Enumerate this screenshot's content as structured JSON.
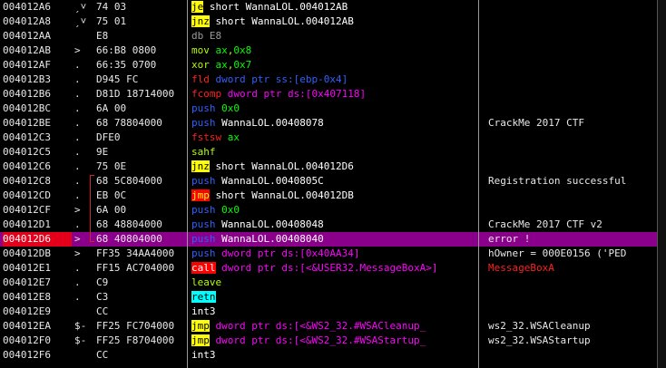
{
  "colors": {
    "background": "#000000",
    "selection": "#8b008b",
    "selected_address": "#e4001b",
    "jump_line": "#cc2a2a"
  },
  "rows": [
    {
      "address": "004012A6",
      "arrow": "ˏ˅",
      "hex": "74 03",
      "comment": "",
      "selected": false,
      "tokens": [
        {
          "t": "je",
          "c": "m-yellow"
        },
        {
          "t": " short WannaLOL.004012AB",
          "c": "c-plain"
        }
      ]
    },
    {
      "address": "004012A8",
      "arrow": "ˏ˅",
      "hex": "75 01",
      "comment": "",
      "selected": false,
      "tokens": [
        {
          "t": "jnz",
          "c": "m-yellow"
        },
        {
          "t": " short WannaLOL.004012AB",
          "c": "c-plain"
        }
      ]
    },
    {
      "address": "004012AA",
      "arrow": "",
      "hex": "E8",
      "comment": "",
      "selected": false,
      "tokens": [
        {
          "t": "db E8",
          "c": "c-gray"
        }
      ]
    },
    {
      "address": "004012AB",
      "arrow": ">",
      "hex": "66:B8 0800",
      "comment": "",
      "selected": false,
      "tokens": [
        {
          "t": "mov ",
          "c": "c-lime"
        },
        {
          "t": "ax",
          "c": "c-green"
        },
        {
          "t": ",",
          "c": "c-lime"
        },
        {
          "t": "0x8",
          "c": "c-green"
        }
      ]
    },
    {
      "address": "004012AF",
      "arrow": ".",
      "hex": "66:35 0700",
      "comment": "",
      "selected": false,
      "tokens": [
        {
          "t": "xor ",
          "c": "c-lime"
        },
        {
          "t": "ax",
          "c": "c-green"
        },
        {
          "t": ",",
          "c": "c-lime"
        },
        {
          "t": "0x7",
          "c": "c-green"
        }
      ]
    },
    {
      "address": "004012B3",
      "arrow": ".",
      "hex": "D945 FC",
      "comment": "",
      "selected": false,
      "tokens": [
        {
          "t": "fld ",
          "c": "c-red"
        },
        {
          "t": "dword ptr ss:[ebp-0x4]",
          "c": "c-blue"
        }
      ]
    },
    {
      "address": "004012B6",
      "arrow": ".",
      "hex": "D81D 18714000",
      "comment": "",
      "selected": false,
      "tokens": [
        {
          "t": "fcomp ",
          "c": "c-red"
        },
        {
          "t": "dword ptr ds:[0x407118]",
          "c": "c-magenta"
        }
      ]
    },
    {
      "address": "004012BC",
      "arrow": ".",
      "hex": "6A 00",
      "comment": "",
      "selected": false,
      "tokens": [
        {
          "t": "push ",
          "c": "c-blue"
        },
        {
          "t": "0x0",
          "c": "c-green"
        }
      ]
    },
    {
      "address": "004012BE",
      "arrow": ".",
      "hex": "68 78804000",
      "comment": "CrackMe 2017 CTF",
      "selected": false,
      "tokens": [
        {
          "t": "push ",
          "c": "c-blue"
        },
        {
          "t": "WannaLOL.00408078",
          "c": "c-plain"
        }
      ]
    },
    {
      "address": "004012C3",
      "arrow": ".",
      "hex": "DFE0",
      "comment": "",
      "selected": false,
      "tokens": [
        {
          "t": "fstsw ",
          "c": "c-red"
        },
        {
          "t": "ax",
          "c": "c-green"
        }
      ]
    },
    {
      "address": "004012C5",
      "arrow": ".",
      "hex": "9E",
      "comment": "",
      "selected": false,
      "tokens": [
        {
          "t": "sahf",
          "c": "c-lime"
        }
      ]
    },
    {
      "address": "004012C6",
      "arrow": ".",
      "hex": "75 0E",
      "comment": "",
      "selected": false,
      "tokens": [
        {
          "t": "jnz",
          "c": "m-yellow"
        },
        {
          "t": " short WannaLOL.004012D6",
          "c": "c-plain"
        }
      ]
    },
    {
      "address": "004012C8",
      "arrow": ".",
      "hex": "68 5C804000",
      "comment": "Registration successful",
      "selected": false,
      "tokens": [
        {
          "t": "push ",
          "c": "c-blue"
        },
        {
          "t": "WannaLOL.0040805C",
          "c": "c-plain"
        }
      ]
    },
    {
      "address": "004012CD",
      "arrow": ".",
      "hex": "EB 0C",
      "comment": "",
      "selected": false,
      "tokens": [
        {
          "t": "jmp",
          "c": "m-red"
        },
        {
          "t": " short WannaLOL.004012DB",
          "c": "c-plain"
        }
      ]
    },
    {
      "address": "004012CF",
      "arrow": ">",
      "hex": "6A 00",
      "comment": "",
      "selected": false,
      "tokens": [
        {
          "t": "push ",
          "c": "c-blue"
        },
        {
          "t": "0x0",
          "c": "c-green"
        }
      ]
    },
    {
      "address": "004012D1",
      "arrow": ".",
      "hex": "68 48804000",
      "comment": "CrackMe 2017 CTF v2",
      "selected": false,
      "tokens": [
        {
          "t": "push ",
          "c": "c-blue"
        },
        {
          "t": "WannaLOL.00408048",
          "c": "c-plain"
        }
      ]
    },
    {
      "address": "004012D6",
      "arrow": ">",
      "hex": "68 40804000",
      "comment": "error !",
      "selected": true,
      "tokens": [
        {
          "t": "push ",
          "c": "c-blue"
        },
        {
          "t": "WannaLOL.00408040",
          "c": "c-plain"
        }
      ]
    },
    {
      "address": "004012DB",
      "arrow": ">",
      "hex": "FF35 34AA4000",
      "comment": "hOwner = 000E0156 ('PED",
      "selected": false,
      "tokens": [
        {
          "t": "push ",
          "c": "c-blue"
        },
        {
          "t": "dword ptr ds:[0x40AA34]",
          "c": "c-magenta"
        }
      ]
    },
    {
      "address": "004012E1",
      "arrow": ".",
      "hex": "FF15 AC704000",
      "comment": "MessageBoxA",
      "commentColor": "#ff2020",
      "selected": false,
      "tokens": [
        {
          "t": "call",
          "c": "m-call"
        },
        {
          "t": " dword ptr ds:[<&USER32.MessageBoxA>]",
          "c": "c-magenta"
        }
      ]
    },
    {
      "address": "004012E7",
      "arrow": ".",
      "hex": "C9",
      "comment": "",
      "selected": false,
      "tokens": [
        {
          "t": "leave",
          "c": "c-lime"
        }
      ]
    },
    {
      "address": "004012E8",
      "arrow": ".",
      "hex": "C3",
      "comment": "",
      "selected": false,
      "tokens": [
        {
          "t": "retn",
          "c": "m-cyan"
        }
      ]
    },
    {
      "address": "004012E9",
      "arrow": "",
      "hex": "CC",
      "comment": "",
      "selected": false,
      "tokens": [
        {
          "t": "int3",
          "c": "c-plain"
        }
      ]
    },
    {
      "address": "004012EA",
      "arrow": "$-",
      "hex": "FF25 FC704000",
      "comment": "ws2_32.WSACleanup",
      "selected": false,
      "tokens": [
        {
          "t": "jmp",
          "c": "m-yellow"
        },
        {
          "t": " dword ptr ds:[<&WS2_32.#WSACleanup_",
          "c": "c-magenta"
        }
      ]
    },
    {
      "address": "004012F0",
      "arrow": "$-",
      "hex": "FF25 F8704000",
      "comment": "ws2_32.WSAStartup",
      "selected": false,
      "tokens": [
        {
          "t": "jmp",
          "c": "m-yellow"
        },
        {
          "t": " dword ptr ds:[<&WS2_32.#WSAStartup_",
          "c": "c-magenta"
        }
      ]
    },
    {
      "address": "004012F6",
      "arrow": "",
      "hex": "CC",
      "comment": "",
      "selected": false,
      "tokens": [
        {
          "t": "int3",
          "c": "c-plain"
        }
      ]
    }
  ]
}
